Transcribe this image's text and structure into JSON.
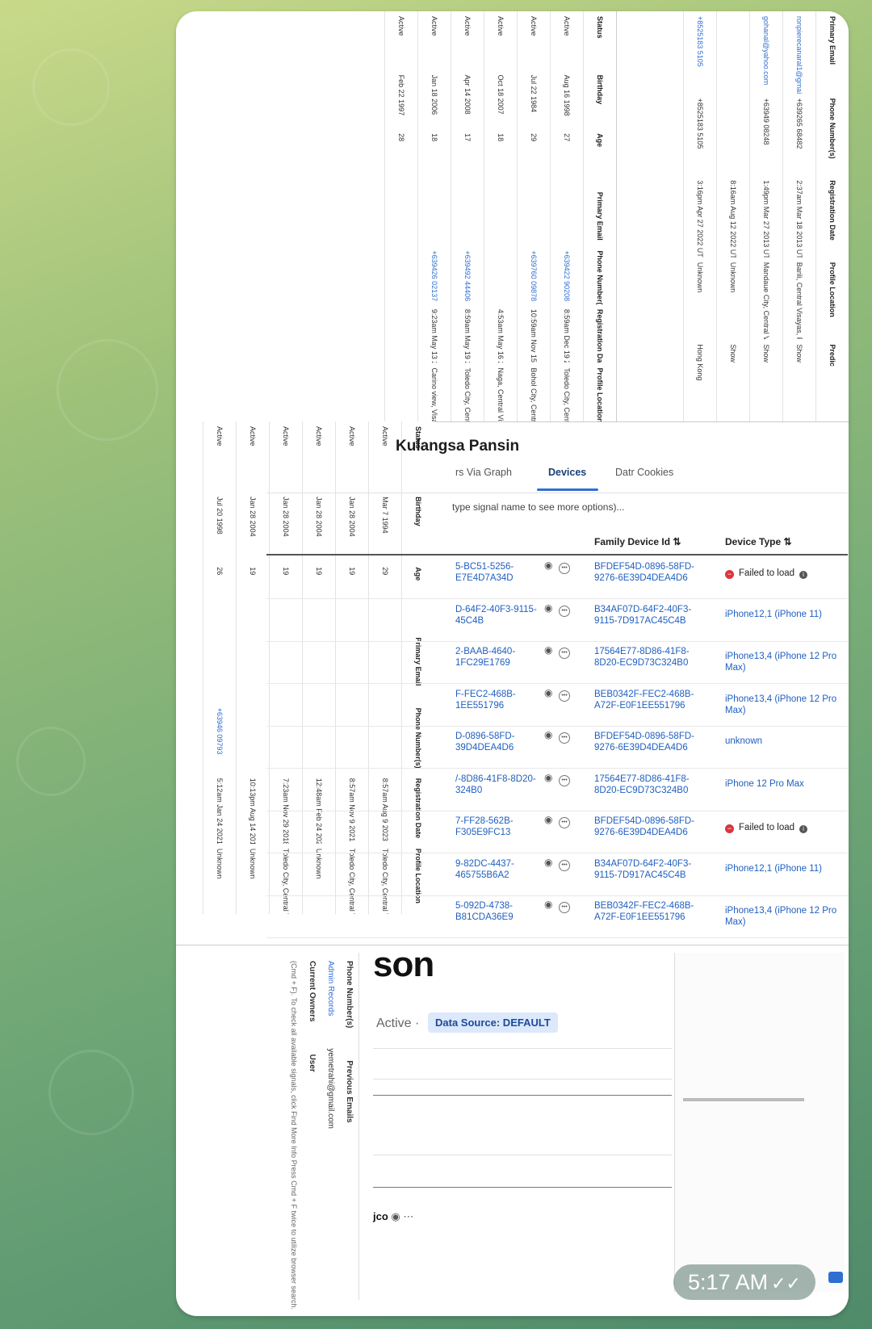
{
  "devices_panel": {
    "title": "Kulangsa Pansin",
    "tabs": [
      "rs Via Graph",
      "Devices",
      "Datr Cookies"
    ],
    "active_tab": "Devices",
    "search_hint": "type signal name to see more options)...",
    "columns": {
      "family": "Family Device Id",
      "type": "Device Type"
    },
    "rows": [
      {
        "id_lines": [
          "5-BC51-5256-",
          "E7E4D7A34D"
        ],
        "family": [
          "BFDEF54D-0896-58FD-",
          "9276-6E39D4DEA4D6"
        ],
        "type": "Failed to load",
        "error": true
      },
      {
        "id_lines": [
          "D-64F2-40F3-9115-",
          "45C4B"
        ],
        "family": [
          "B34AF07D-64F2-40F3-",
          "9115-7D917AC45C4B"
        ],
        "type": "iPhone12,1 (iPhone 11)",
        "error": false
      },
      {
        "id_lines": [
          "2-BAAB-4640-",
          "1FC29E1769"
        ],
        "family": [
          "17564E77-8D86-41F8-",
          "8D20-EC9D73C324B0"
        ],
        "type": "iPhone13,4 (iPhone 12 Pro Max)",
        "error": false
      },
      {
        "id_lines": [
          "F-FEC2-468B-",
          "1EE551796"
        ],
        "family": [
          "BEB0342F-FEC2-468B-",
          "A72F-E0F1EE551796"
        ],
        "type": "iPhone13,4 (iPhone 12 Pro Max)",
        "error": false
      },
      {
        "id_lines": [
          "D-0896-58FD-",
          "39D4DEA4D6"
        ],
        "family": [
          "BFDEF54D-0896-58FD-",
          "9276-6E39D4DEA4D6"
        ],
        "type": "unknown",
        "error": false
      },
      {
        "id_lines": [
          "/-8D86-41F8-8D20-",
          "324B0"
        ],
        "family": [
          "17564E77-8D86-41F8-",
          "8D20-EC9D73C324B0"
        ],
        "type": "iPhone 12 Pro Max",
        "error": false
      },
      {
        "id_lines": [
          "7-FF28-562B-",
          "F305E9FC13"
        ],
        "family": [
          "BFDEF54D-0896-58FD-",
          "9276-6E39D4DEA4D6"
        ],
        "type": "Failed to load",
        "error": true
      },
      {
        "id_lines": [
          "9-82DC-4437-",
          "465755B6A2"
        ],
        "family": [
          "B34AF07D-64F2-40F3-",
          "9115-7D917AC45C4B"
        ],
        "type": "iPhone12,1 (iPhone 11)",
        "error": false
      },
      {
        "id_lines": [
          "5-092D-4738-",
          "B81CDA36E9"
        ],
        "family": [
          "BEB0342F-FEC2-468B-",
          "A72F-E0F1EE551796"
        ],
        "type": "iPhone13,4 (iPhone 12 Pro Max)",
        "error": false
      }
    ]
  },
  "profile_fragment": {
    "name_fragment": "son",
    "status": "Active ·",
    "data_source": "Data Source: DEFAULT",
    "tail_text": "jco",
    "side_labels": {
      "phone_numbers": "Phone Number(s)",
      "admin_records": "Admin Records",
      "previous_emails": "Previous Emails",
      "current_owners": "Current Owners",
      "user": "User",
      "email_value": "yemetrahi@gmail.com",
      "hint": "(Cmd + F). To check all available signals, click Find More Info Press Cmd + F twice to utilize browser search."
    }
  },
  "rotated_table_top": {
    "headers": [
      "Primary Email",
      "Phone Number(s)",
      "Registration Date",
      "Profile Location",
      "Predic"
    ],
    "rows": [
      [
        "ronpierecanaral1@gmail.co",
        "+639265 68482",
        "2:37am Mar 18 2013 UTC+00:00",
        "Barili, Central Visayas, Philippines (10.118, 123.511)",
        "Show"
      ],
      [
        "gohanal@yahoo.com",
        "+63949 08248",
        "1:49pm Mar 27 2013 UTC+00:00",
        "Mandaue City, Central Visayas (10.345, 123.947)",
        "Show"
      ],
      [
        "",
        "",
        "8:16am Aug 12 2022 UTC+00:00",
        "Unknown",
        "Show"
      ],
      [
        "+8525183 5105",
        "+8525183 5105",
        "3:16pm Apr 27 2022 UTC+00:00",
        "Unknown",
        "Hong Kong"
      ]
    ]
  },
  "rotated_table_left": {
    "headers": [
      "Status",
      "Birthday",
      "Age",
      "Primary Email",
      "Phone Number(s)",
      "Registration Date",
      "Profile Location"
    ],
    "rows": [
      [
        "Active",
        "Aug 16 1998",
        "27",
        "",
        "+639422 90208",
        "8:59am Dec 19 2018 UTC+00:00",
        "Toledo City, Central Visayas"
      ],
      [
        "Active",
        "Jul 22 1984",
        "29",
        "",
        "+639760 09878",
        "10:59am Nov 15 2017 UTC+00:00",
        "Bohol City, Central Visayas"
      ],
      [
        "Active",
        "Oct 18 2007",
        "18",
        "",
        "",
        "4:53am May 16 2021 UTC+00:00",
        "Naga, Central Visayas"
      ],
      [
        "Active",
        "Apr 14 2008",
        "17",
        "",
        "+639492 44406",
        "8:59am May 19 2019 UTC+00:00",
        "Toledo City, Central Visayas"
      ],
      [
        "Active",
        "Jan 18 2006",
        "18",
        "",
        "+639426 02137",
        "9:23am May 13 2011 UTC+00:00",
        "Carino view, Visayas"
      ],
      [
        "Active",
        "Feb 22 1997",
        "28",
        "",
        "",
        "",
        ""
      ]
    ]
  },
  "rotated_table_mid": {
    "headers": [
      "Status",
      "Birthday",
      "Age",
      "Primary Email",
      "Phone Number(s)",
      "Registration Date",
      "Profile Location"
    ],
    "rows": [
      [
        "Active",
        "Mar 7 1994",
        "29",
        "",
        "",
        "8:57am Aug 9 2023 UTC+00:00",
        "Toledo City, Central Visayas"
      ],
      [
        "Active",
        "Jan 28 2004",
        "19",
        "",
        "",
        "8:57am Nov 9 2021 UTC+00:00",
        "Toledo City, Central Visayas"
      ],
      [
        "Active",
        "Jan 28 2004",
        "19",
        "",
        "",
        "12:48am Feb 24 2020 UTC+00:00",
        "Unknown"
      ],
      [
        "Active",
        "Jan 28 2004",
        "19",
        "",
        "",
        "7:23am Nov 29 2018 UTC+00:00",
        "Toledo City, Central Visayas"
      ],
      [
        "Active",
        "Jan 28 2004",
        "19",
        "",
        "",
        "10:13pm Aug 14 2019 UTC+00:00",
        "Unknown"
      ],
      [
        "Active",
        "Jul 20 1998",
        "26",
        "",
        "+63946 09793",
        "5:12am Jan 24 2021 UTC+00:00",
        "Unknown"
      ]
    ]
  },
  "timestamp": "5:17 AM",
  "colors": {
    "link": "#1f5fbf",
    "error": "#d9363e",
    "badge_bg": "#dce8fb",
    "bubble": "#ffffff"
  }
}
